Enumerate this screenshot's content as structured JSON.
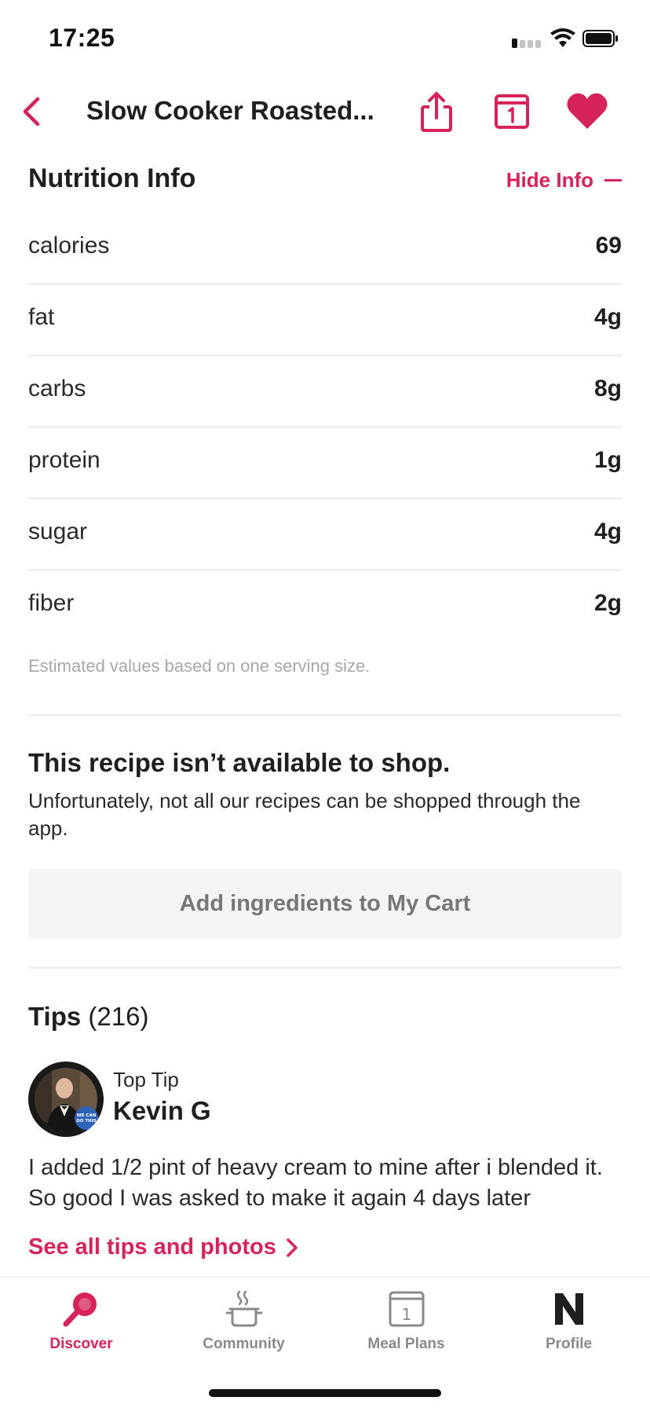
{
  "status_bar": {
    "time": "17:25"
  },
  "header": {
    "title": "Slow Cooker Roasted..."
  },
  "nutrition": {
    "title": "Nutrition Info",
    "toggle_label": "Hide Info",
    "rows": [
      {
        "label": "calories",
        "value": "69"
      },
      {
        "label": "fat",
        "value": "4g"
      },
      {
        "label": "carbs",
        "value": "8g"
      },
      {
        "label": "protein",
        "value": "1g"
      },
      {
        "label": "sugar",
        "value": "4g"
      },
      {
        "label": "fiber",
        "value": "2g"
      }
    ],
    "note": "Estimated values based on one serving size."
  },
  "shop": {
    "title": "This recipe isn’t available to shop.",
    "description": "Unfortunately, not all our recipes can be shopped through the app.",
    "button_label": "Add ingredients to My Cart"
  },
  "tips": {
    "title": "Tips",
    "count": "(216)",
    "top_tip": {
      "badge": "Top Tip",
      "author": "Kevin G",
      "text": "I added 1/2 pint of heavy cream to mine after i blended it. So good I was asked to make it again 4 days later"
    },
    "see_all_label": "See all tips and photos"
  },
  "tab_bar": {
    "tabs": [
      {
        "label": "Discover",
        "icon": "search-icon",
        "active": true
      },
      {
        "label": "Community",
        "icon": "pot-icon",
        "active": false
      },
      {
        "label": "Meal Plans",
        "icon": "calendar-icon",
        "active": false
      },
      {
        "label": "Profile",
        "icon": "profile-logo-icon",
        "active": false
      }
    ],
    "meal_plans_icon_day": "1"
  },
  "colors": {
    "accent": "#d6245b",
    "text": "#1f1f1f",
    "muted": "#8a8a8a",
    "divider": "#efefef"
  }
}
